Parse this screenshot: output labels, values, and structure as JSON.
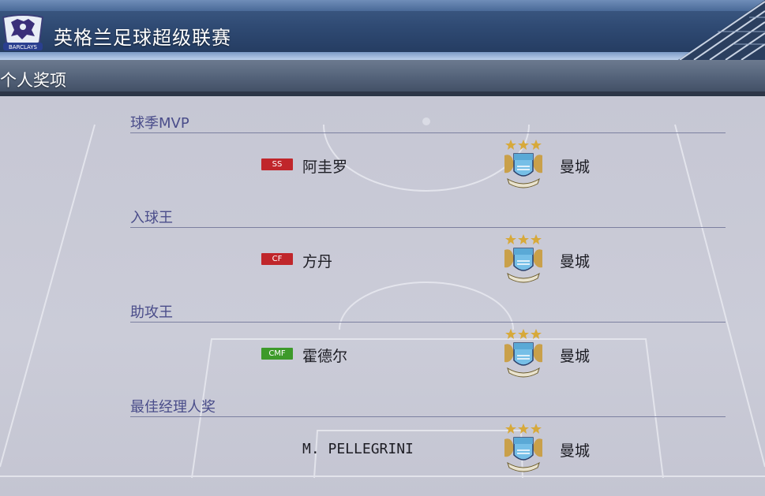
{
  "header": {
    "title": "英格兰足球超级联赛",
    "logo_text": "BARCLAYS"
  },
  "subheader": {
    "title": "个人奖项"
  },
  "awards": [
    {
      "title": "球季MVP",
      "position": "SS",
      "position_color": "#c0262b",
      "name": "阿圭罗",
      "club_icon": "manchester-city-crest",
      "club": "曼城"
    },
    {
      "title": "入球王",
      "position": "CF",
      "position_color": "#c0262b",
      "name": "方丹",
      "club_icon": "manchester-city-crest",
      "club": "曼城"
    },
    {
      "title": "助攻王",
      "position": "CMF",
      "position_color": "#3d9a2a",
      "name": "霍德尔",
      "club_icon": "manchester-city-crest",
      "club": "曼城"
    },
    {
      "title": "最佳经理人奖",
      "name": "M. PELLEGRINI",
      "club_icon": "manchester-city-crest",
      "club": "曼城"
    }
  ]
}
